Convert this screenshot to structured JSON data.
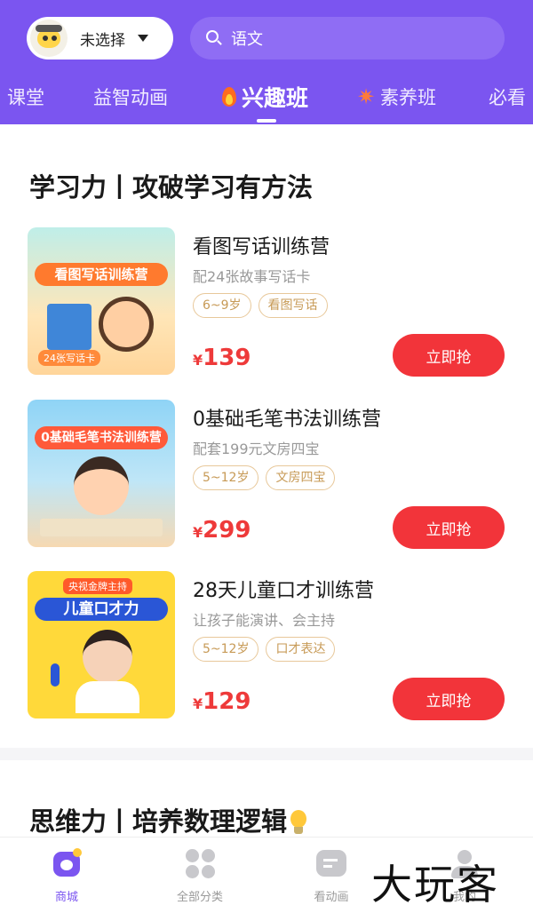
{
  "header": {
    "selector_label": "未选择",
    "search_text": "语文",
    "tabs": [
      {
        "label": "课堂"
      },
      {
        "label": "益智动画"
      },
      {
        "label": "兴趣班"
      },
      {
        "label": "素养班"
      },
      {
        "label": "必看"
      }
    ],
    "active_tab": "兴趣班"
  },
  "sections": [
    {
      "title": "学习力丨攻破学习有方法"
    },
    {
      "title": "思维力丨培养数理逻辑"
    }
  ],
  "products": [
    {
      "thumb_caption": "看图写话训练营",
      "thumb_note": "24张写话卡",
      "name": "看图写话训练营",
      "subtitle": "配24张故事写话卡",
      "tags": [
        "6~9岁",
        "看图写话"
      ],
      "currency": "¥",
      "price": "139",
      "button": "立即抢"
    },
    {
      "thumb_caption": "0基础毛笔书法训练营",
      "thumb_note": "",
      "name": "0基础毛笔书法训练营",
      "subtitle": "配套199元文房四宝",
      "tags": [
        "5~12岁",
        "文房四宝"
      ],
      "currency": "¥",
      "price": "299",
      "button": "立即抢"
    },
    {
      "thumb_caption": "儿童口才力",
      "thumb_note": "央视金牌主持",
      "name": "28天儿童口才训练营",
      "subtitle": "让孩子能演讲、会主持",
      "tags": [
        "5~12岁",
        "口才表达"
      ],
      "currency": "¥",
      "price": "129",
      "button": "立即抢"
    }
  ],
  "bottom_nav": [
    {
      "label": "商城",
      "icon": "shop-icon"
    },
    {
      "label": "全部分类",
      "icon": "grid-icon"
    },
    {
      "label": "看动画",
      "icon": "video-icon"
    },
    {
      "label": "我的",
      "icon": "profile-icon"
    }
  ],
  "watermark": "大玩客",
  "colors": {
    "brand_purple": "#7b55f0",
    "price_red": "#ee3a3a",
    "button_red": "#f2343a",
    "tag_gold": "#c79a56"
  }
}
